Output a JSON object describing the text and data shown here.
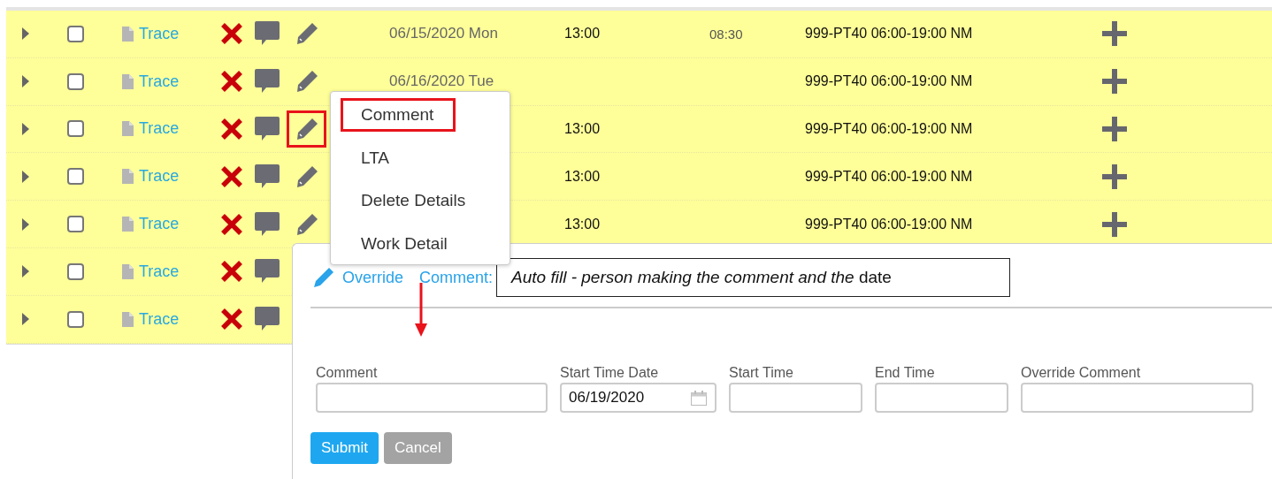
{
  "rows": [
    {
      "expanded": false,
      "checked": false,
      "link": "Trace",
      "edit_highlighted": false,
      "date": "06/15/2020 Mon",
      "start": "13:00",
      "end": "08:30",
      "shift": "999-PT40 06:00-19:00 NM",
      "add": true
    },
    {
      "expanded": false,
      "checked": false,
      "link": "Trace",
      "edit_highlighted": false,
      "date": "06/16/2020 Tue",
      "shift": "999-PT40 06:00-19:00 NM",
      "add": true
    },
    {
      "expanded": false,
      "checked": false,
      "link": "Trace",
      "edit_highlighted": true,
      "start": "13:00",
      "shift": "999-PT40 06:00-19:00 NM",
      "add": true
    },
    {
      "expanded": false,
      "checked": false,
      "link": "Trace",
      "edit_highlighted": false,
      "start": "13:00",
      "shift": "999-PT40 06:00-19:00 NM",
      "add": true
    },
    {
      "expanded": false,
      "checked": false,
      "link": "Trace",
      "edit_highlighted": false,
      "start": "13:00",
      "shift": "999-PT40 06:00-19:00 NM",
      "add": true
    },
    {
      "expanded": false,
      "checked": false,
      "link": "Trace"
    },
    {
      "expanded": false,
      "checked": false,
      "link": "Trace"
    }
  ],
  "menu": {
    "items": [
      {
        "label": "Comment",
        "highlighted": true
      },
      {
        "label": "LTA",
        "highlighted": false
      },
      {
        "label": "Delete Details",
        "highlighted": false
      },
      {
        "label": "Work Detail",
        "highlighted": false
      }
    ]
  },
  "panel": {
    "title": "Override",
    "subtitle": "Comment:",
    "callout": "*Auto fill - person making the comment and the* date",
    "fields": [
      {
        "label": "Comment",
        "kind": "text"
      },
      {
        "label": "Start Time Date",
        "kind": "date",
        "value": "06/19/2020"
      },
      {
        "label": "Start Time",
        "kind": "text"
      },
      {
        "label": "End Time",
        "kind": "text"
      },
      {
        "label": "Override Comment",
        "kind": "text"
      }
    ],
    "buttons": [
      {
        "label": "Submit",
        "kind": "primary"
      },
      {
        "label": "Cancel",
        "kind": "secondary"
      }
    ]
  }
}
